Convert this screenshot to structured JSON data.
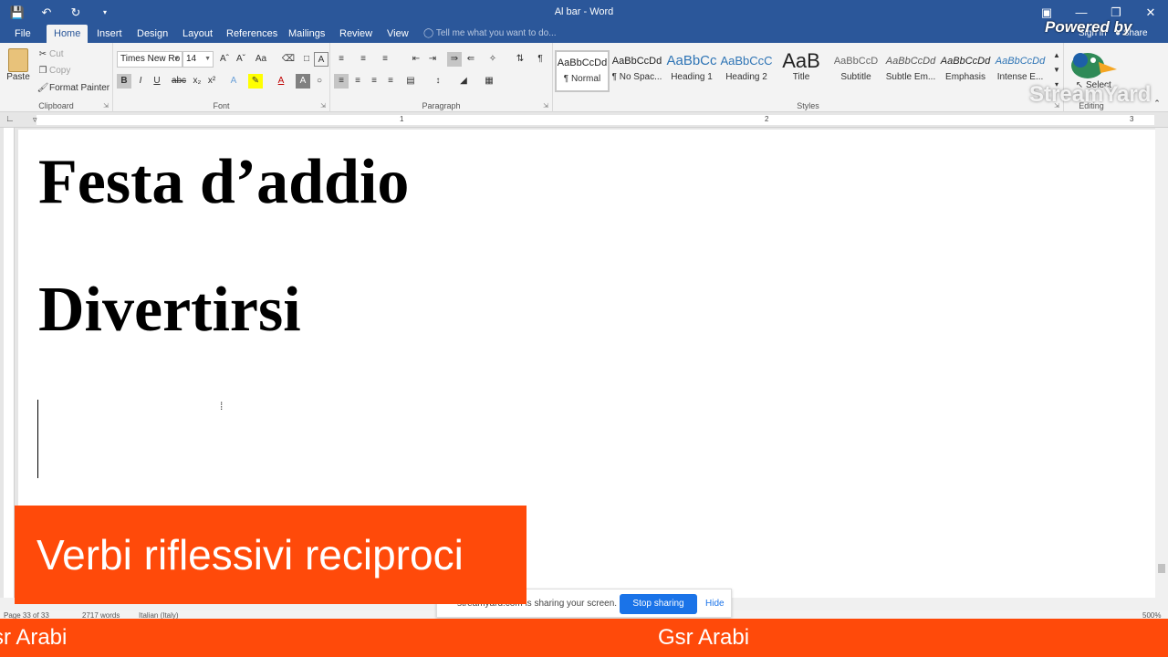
{
  "window": {
    "title": "Al bar - Word",
    "qat": [
      "save-icon",
      "undo-icon",
      "redo-icon",
      "customize-icon"
    ],
    "controls": [
      "ribbon-options-icon",
      "minimize-icon",
      "restore-icon",
      "close-icon"
    ]
  },
  "tabs": {
    "items": [
      "File",
      "Home",
      "Insert",
      "Design",
      "Layout",
      "References",
      "Mailings",
      "Review",
      "View"
    ],
    "active": "Home",
    "tell_me": "Tell me what you want to do...",
    "sign_in": "Sign in",
    "share": "Share"
  },
  "ribbon": {
    "clipboard": {
      "paste": "Paste",
      "cut": "Cut",
      "copy": "Copy",
      "format_painter": "Format Painter",
      "label": "Clipboard"
    },
    "font": {
      "name": "Times New Ro",
      "size": "14",
      "label": "Font",
      "buttons": [
        "B",
        "I",
        "U",
        "abc",
        "x₂",
        "x²",
        "A",
        "A"
      ]
    },
    "paragraph": {
      "label": "Paragraph"
    },
    "styles": {
      "label": "Styles",
      "items": [
        {
          "sample": "AaBbCcDd",
          "name": "¶ Normal"
        },
        {
          "sample": "AaBbCcDd",
          "name": "¶ No Spac..."
        },
        {
          "sample": "AaBbCc",
          "name": "Heading 1"
        },
        {
          "sample": "AaBbCcC",
          "name": "Heading 2"
        },
        {
          "sample": "AaB",
          "name": "Title"
        },
        {
          "sample": "AaBbCcD",
          "name": "Subtitle"
        },
        {
          "sample": "AaBbCcDd",
          "name": "Subtle Em..."
        },
        {
          "sample": "AaBbCcDd",
          "name": "Emphasis"
        },
        {
          "sample": "AaBbCcDd",
          "name": "Intense E..."
        }
      ]
    },
    "editing": {
      "select": "Select",
      "label": "Editing"
    }
  },
  "ruler": {
    "marks": [
      "1",
      "2",
      "3"
    ]
  },
  "document": {
    "line1": "Festa d’addio",
    "line2": "Divertirsi"
  },
  "status": {
    "page": "Page 33 of 33",
    "words": "2717 words",
    "language": "Italian (Italy)",
    "zoom": "500%"
  },
  "share_bar": {
    "message": "streamyard.com is sharing your screen.",
    "stop": "Stop sharing",
    "hide": "Hide"
  },
  "overlay": {
    "caption": "Verbi riflessivi reciproci",
    "footer_left": "sr Arabi",
    "footer_right": "Gsr Arabi",
    "powered": "Powered by",
    "brand": "StreamYard",
    "accent": "#ff4a0a",
    "word_blue": "#2b579a"
  }
}
